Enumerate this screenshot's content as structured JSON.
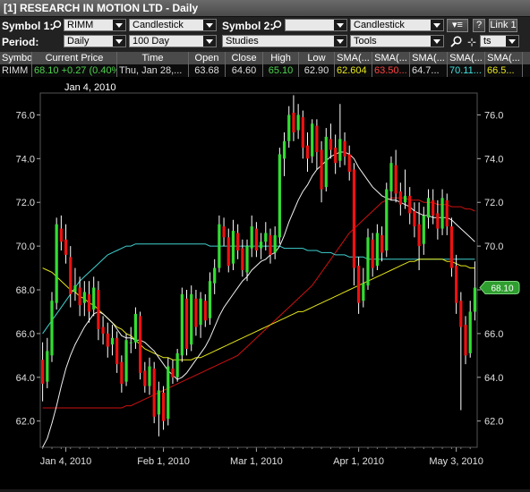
{
  "window": {
    "title": "[1] RESEARCH IN MOTION LTD - Daily"
  },
  "toolbar1": {
    "symbol1_label": "Symbol 1:",
    "symbol1_value": "RIMM",
    "chart_type1": "Candlestick",
    "symbol2_label": "Symbol 2:",
    "symbol2_value": "",
    "chart_type2": "Candlestick",
    "help_label": "?",
    "link_label": "Link 1"
  },
  "toolbar2": {
    "period_label": "Period:",
    "period_value": "Daily",
    "range_value": "100 Day",
    "studies_value": "Studies",
    "tools_value": "Tools",
    "extra_value": "ts"
  },
  "quote_table": {
    "headers": [
      "Symbol",
      "Current Price",
      "Time",
      "Open",
      "Close",
      "High",
      "Low",
      "SMA(...",
      "SMA(...",
      "SMA(...",
      "SMA(...",
      "SMA(..."
    ],
    "row": {
      "symbol": "RIMM",
      "current_price": "68.10",
      "change": "+0.27 (0.40%)",
      "time": "Thu, Jan 28,...",
      "open": "63.68",
      "close": "64.60",
      "high": "65.10",
      "low": "62.90",
      "sma1": "62.604",
      "sma2": "63.50...",
      "sma3": "64.7...",
      "sma4": "70.11...",
      "sma5": "66.5..."
    },
    "colors": {
      "current_price": "#4cd24c",
      "change": "#4cd24c",
      "high": "#4cd24c",
      "sma1": "#e6e619",
      "sma2": "#ff4040",
      "sma3": "#e0e0e0",
      "sma4": "#40e0e0",
      "sma5": "#e6e619"
    }
  },
  "chart_data": {
    "type": "candlestick",
    "crosshair_date_label": "Jan 4, 2010",
    "last_price_badge": "68.10",
    "ylim": [
      60.8,
      77.0
    ],
    "y_ticks": [
      "62.0",
      "64.0",
      "66.0",
      "68.0",
      "70.0",
      "72.0",
      "74.0",
      "76.0"
    ],
    "y_tick_values": [
      62,
      64,
      66,
      68,
      70,
      72,
      74,
      76
    ],
    "x_ticks": [
      "Jan 4, 2010",
      "Feb 1, 2010",
      "Mar 1, 2010",
      "Apr 1, 2010",
      "May 3, 2010"
    ],
    "x_tick_index": [
      5,
      26,
      46,
      68,
      89
    ],
    "colors": {
      "up": "#33dd33",
      "down": "#ee1111",
      "wick": "#ffffff",
      "ma_white": "#f0f0f0",
      "ma_yellow": "#e6e619",
      "ma_red": "#cc1111",
      "ma_cyan": "#40d0d0"
    },
    "candles": [
      [
        64.8,
        63.7,
        65.6,
        62.9
      ],
      [
        63.8,
        65.2,
        65.8,
        63.5
      ],
      [
        65.0,
        67.5,
        67.9,
        64.7
      ],
      [
        67.4,
        71.0,
        71.3,
        67.1
      ],
      [
        70.8,
        70.2,
        71.4,
        69.8
      ],
      [
        70.3,
        69.6,
        71.0,
        69.2
      ],
      [
        69.5,
        67.8,
        70.0,
        67.2
      ],
      [
        67.9,
        68.2,
        69.0,
        67.5
      ],
      [
        68.1,
        67.3,
        68.6,
        66.8
      ],
      [
        67.4,
        67.9,
        68.4,
        66.8
      ],
      [
        67.8,
        67.0,
        68.4,
        66.5
      ],
      [
        67.1,
        68.1,
        68.6,
        66.8
      ],
      [
        68.0,
        66.2,
        68.4,
        65.7
      ],
      [
        66.3,
        66.0,
        66.8,
        65.5
      ],
      [
        66.0,
        65.4,
        66.5,
        64.9
      ],
      [
        65.5,
        65.8,
        66.4,
        65.0
      ],
      [
        65.8,
        64.6,
        66.1,
        64.2
      ],
      [
        64.7,
        63.7,
        65.0,
        63.3
      ],
      [
        63.8,
        65.7,
        66.0,
        63.6
      ],
      [
        65.6,
        65.6,
        66.3,
        65.1
      ],
      [
        65.6,
        66.9,
        67.2,
        65.3
      ],
      [
        66.8,
        64.2,
        67.0,
        63.9
      ],
      [
        64.3,
        63.6,
        64.7,
        63.3
      ],
      [
        63.6,
        64.5,
        64.9,
        63.2
      ],
      [
        64.4,
        62.2,
        64.7,
        61.9
      ],
      [
        62.3,
        63.4,
        63.8,
        61.3
      ],
      [
        63.3,
        62.0,
        63.6,
        61.6
      ],
      [
        62.1,
        64.5,
        64.9,
        61.8
      ],
      [
        64.4,
        64.0,
        64.8,
        63.7
      ],
      [
        64.0,
        65.1,
        65.3,
        63.8
      ],
      [
        65.0,
        67.8,
        68.1,
        64.7
      ],
      [
        67.6,
        65.3,
        68.0,
        65.0
      ],
      [
        65.5,
        67.8,
        68.2,
        65.2
      ],
      [
        67.6,
        66.3,
        68.0,
        65.9
      ],
      [
        66.4,
        67.6,
        67.9,
        65.8
      ],
      [
        67.5,
        66.6,
        67.8,
        66.3
      ],
      [
        66.7,
        68.4,
        68.8,
        66.4
      ],
      [
        68.3,
        69.0,
        69.4,
        67.8
      ],
      [
        69.0,
        71.0,
        71.4,
        68.8
      ],
      [
        70.9,
        70.4,
        71.3,
        70.0
      ],
      [
        70.4,
        69.1,
        70.8,
        68.8
      ],
      [
        69.2,
        70.7,
        71.2,
        68.9
      ],
      [
        70.6,
        69.8,
        71.0,
        69.4
      ],
      [
        69.9,
        68.9,
        70.3,
        68.6
      ],
      [
        68.8,
        70.0,
        70.3,
        68.4
      ],
      [
        69.9,
        70.9,
        71.4,
        69.5
      ],
      [
        70.8,
        69.8,
        71.1,
        69.5
      ],
      [
        69.9,
        70.2,
        70.6,
        69.4
      ],
      [
        70.2,
        70.6,
        71.1,
        69.8
      ],
      [
        70.5,
        69.6,
        70.8,
        69.2
      ],
      [
        69.7,
        70.5,
        70.9,
        69.4
      ],
      [
        70.4,
        74.2,
        74.5,
        70.1
      ],
      [
        74.0,
        74.8,
        75.2,
        73.2
      ],
      [
        74.8,
        76.0,
        76.4,
        74.5
      ],
      [
        76.1,
        75.2,
        76.9,
        74.8
      ],
      [
        75.3,
        76.0,
        76.5,
        74.9
      ],
      [
        75.9,
        74.5,
        76.2,
        74.0
      ],
      [
        74.6,
        74.0,
        75.2,
        73.4
      ],
      [
        74.1,
        75.6,
        75.8,
        73.8
      ],
      [
        75.5,
        74.3,
        75.8,
        73.5
      ],
      [
        74.4,
        72.6,
        74.8,
        72.0
      ],
      [
        72.7,
        75.0,
        75.4,
        72.5
      ],
      [
        74.9,
        74.4,
        75.6,
        74.0
      ],
      [
        74.5,
        73.8,
        75.1,
        73.3
      ],
      [
        73.9,
        74.9,
        76.5,
        73.6
      ],
      [
        74.8,
        74.1,
        75.2,
        73.7
      ],
      [
        74.2,
        73.4,
        74.6,
        73.0
      ],
      [
        73.5,
        69.0,
        73.8,
        68.2
      ],
      [
        69.1,
        67.4,
        69.5,
        66.9
      ],
      [
        67.5,
        68.3,
        69.0,
        67.2
      ],
      [
        68.2,
        70.4,
        70.8,
        68.0
      ],
      [
        70.3,
        69.0,
        70.6,
        68.6
      ],
      [
        69.1,
        70.6,
        71.0,
        68.9
      ],
      [
        70.5,
        69.7,
        70.9,
        69.3
      ],
      [
        69.8,
        72.6,
        72.9,
        69.5
      ],
      [
        72.5,
        73.8,
        74.1,
        72.1
      ],
      [
        73.7,
        72.4,
        74.4,
        72.0
      ],
      [
        72.5,
        71.9,
        72.9,
        71.4
      ],
      [
        72.0,
        72.3,
        73.5,
        71.7
      ],
      [
        72.3,
        71.5,
        72.7,
        71.0
      ],
      [
        71.6,
        70.9,
        72.0,
        70.4
      ],
      [
        71.0,
        70.0,
        72.0,
        68.9
      ],
      [
        70.1,
        71.4,
        71.8,
        69.6
      ],
      [
        71.3,
        72.2,
        72.6,
        70.8
      ],
      [
        72.1,
        71.4,
        72.6,
        71.0
      ],
      [
        71.5,
        70.8,
        72.1,
        70.3
      ],
      [
        70.8,
        72.2,
        72.6,
        70.5
      ],
      [
        72.1,
        70.9,
        72.4,
        70.5
      ],
      [
        70.9,
        69.0,
        71.3,
        68.6
      ],
      [
        69.1,
        67.4,
        69.6,
        66.9
      ],
      [
        67.5,
        66.3,
        67.9,
        62.5
      ],
      [
        66.4,
        65.0,
        66.8,
        64.6
      ],
      [
        65.1,
        67.0,
        67.5,
        64.9
      ],
      [
        67.0,
        68.1,
        69.3,
        66.6
      ]
    ],
    "ma_white": [
      60.8,
      61.2,
      61.9,
      62.7,
      63.6,
      64.4,
      65.0,
      65.5,
      65.9,
      66.3,
      66.6,
      66.9,
      67.0,
      66.9,
      66.7,
      66.5,
      66.2,
      65.9,
      65.8,
      65.8,
      65.7,
      65.7,
      65.6,
      65.4,
      65.2,
      64.9,
      64.6,
      64.3,
      64.1,
      63.9,
      64.0,
      64.2,
      64.5,
      64.8,
      65.1,
      65.4,
      65.8,
      66.3,
      66.8,
      67.2,
      67.5,
      67.8,
      68.1,
      68.4,
      68.6,
      68.9,
      69.1,
      69.3,
      69.4,
      69.6,
      69.7,
      70.0,
      70.5,
      71.1,
      71.6,
      72.1,
      72.5,
      72.8,
      73.2,
      73.5,
      73.7,
      73.9,
      74.1,
      74.2,
      74.3,
      74.3,
      74.2,
      74.0,
      73.6,
      73.3,
      73.0,
      72.7,
      72.5,
      72.3,
      72.2,
      72.1,
      72.1,
      72.0,
      71.9,
      71.8,
      71.6,
      71.5,
      71.4,
      71.4,
      71.3,
      71.3,
      71.3,
      71.3,
      71.2,
      71.0,
      70.8,
      70.6,
      70.4,
      70.2
    ],
    "ma_yellow": [
      69.0,
      68.9,
      68.8,
      68.6,
      68.4,
      68.2,
      68.0,
      67.9,
      67.7,
      67.6,
      67.4,
      67.3,
      67.1,
      66.9,
      66.7,
      66.5,
      66.3,
      66.2,
      66.0,
      65.9,
      65.7,
      65.5,
      65.3,
      65.2,
      65.1,
      65.0,
      64.9,
      64.9,
      64.8,
      64.8,
      64.8,
      64.8,
      64.8,
      64.9,
      64.9,
      65.0,
      65.1,
      65.2,
      65.3,
      65.4,
      65.5,
      65.6,
      65.7,
      65.8,
      65.9,
      66.0,
      66.1,
      66.2,
      66.3,
      66.4,
      66.5,
      66.6,
      66.7,
      66.8,
      66.9,
      67.0,
      67.0,
      67.1,
      67.2,
      67.3,
      67.4,
      67.5,
      67.6,
      67.7,
      67.8,
      67.9,
      68.0,
      68.1,
      68.2,
      68.3,
      68.4,
      68.5,
      68.6,
      68.7,
      68.8,
      68.9,
      69.0,
      69.1,
      69.2,
      69.3,
      69.3,
      69.4,
      69.4,
      69.4,
      69.4,
      69.4,
      69.4,
      69.3,
      69.3,
      69.2,
      69.1,
      69.1,
      69.0,
      69.0
    ],
    "ma_cyan": [
      66.0,
      66.3,
      66.6,
      66.9,
      67.2,
      67.5,
      67.8,
      68.1,
      68.4,
      68.6,
      68.8,
      69.0,
      69.2,
      69.4,
      69.6,
      69.7,
      69.8,
      69.9,
      70.0,
      70.0,
      70.1,
      70.1,
      70.1,
      70.1,
      70.1,
      70.1,
      70.1,
      70.1,
      70.1,
      70.1,
      70.1,
      70.1,
      70.1,
      70.1,
      70.1,
      70.1,
      70.0,
      70.0,
      70.0,
      70.0,
      70.0,
      70.0,
      70.0,
      70.0,
      70.0,
      70.0,
      70.0,
      70.0,
      70.0,
      70.0,
      70.0,
      70.0,
      69.9,
      69.9,
      69.9,
      69.9,
      69.9,
      69.8,
      69.8,
      69.8,
      69.7,
      69.7,
      69.7,
      69.6,
      69.6,
      69.6,
      69.5,
      69.5,
      69.5,
      69.5,
      69.4,
      69.4,
      69.4,
      69.4,
      69.4,
      69.4,
      69.4,
      69.4,
      69.4,
      69.4,
      69.4,
      69.4,
      69.4,
      69.4,
      69.4,
      69.4,
      69.4,
      69.4,
      69.4,
      69.4,
      69.4,
      69.4,
      69.4,
      69.4
    ],
    "ma_red": [
      62.6,
      62.6,
      62.6,
      62.6,
      62.6,
      62.6,
      62.6,
      62.6,
      62.6,
      62.6,
      62.6,
      62.6,
      62.6,
      62.6,
      62.6,
      62.6,
      62.6,
      62.6,
      62.7,
      62.7,
      62.8,
      62.9,
      63.0,
      63.1,
      63.2,
      63.3,
      63.4,
      63.5,
      63.6,
      63.7,
      63.8,
      63.9,
      64.0,
      64.1,
      64.2,
      64.3,
      64.4,
      64.5,
      64.6,
      64.7,
      64.8,
      64.9,
      65.0,
      65.2,
      65.4,
      65.6,
      65.8,
      66.0,
      66.2,
      66.4,
      66.6,
      66.8,
      67.0,
      67.2,
      67.4,
      67.6,
      67.8,
      68.0,
      68.2,
      68.5,
      68.8,
      69.1,
      69.4,
      69.7,
      70.0,
      70.3,
      70.6,
      70.8,
      71.0,
      71.2,
      71.4,
      71.6,
      71.8,
      72.0,
      72.1,
      72.2,
      72.2,
      72.2,
      72.2,
      72.1,
      72.1,
      72.1,
      72.0,
      72.0,
      72.0,
      71.9,
      71.9,
      71.9,
      71.8,
      71.8,
      71.8,
      71.7,
      71.7,
      71.6
    ]
  }
}
